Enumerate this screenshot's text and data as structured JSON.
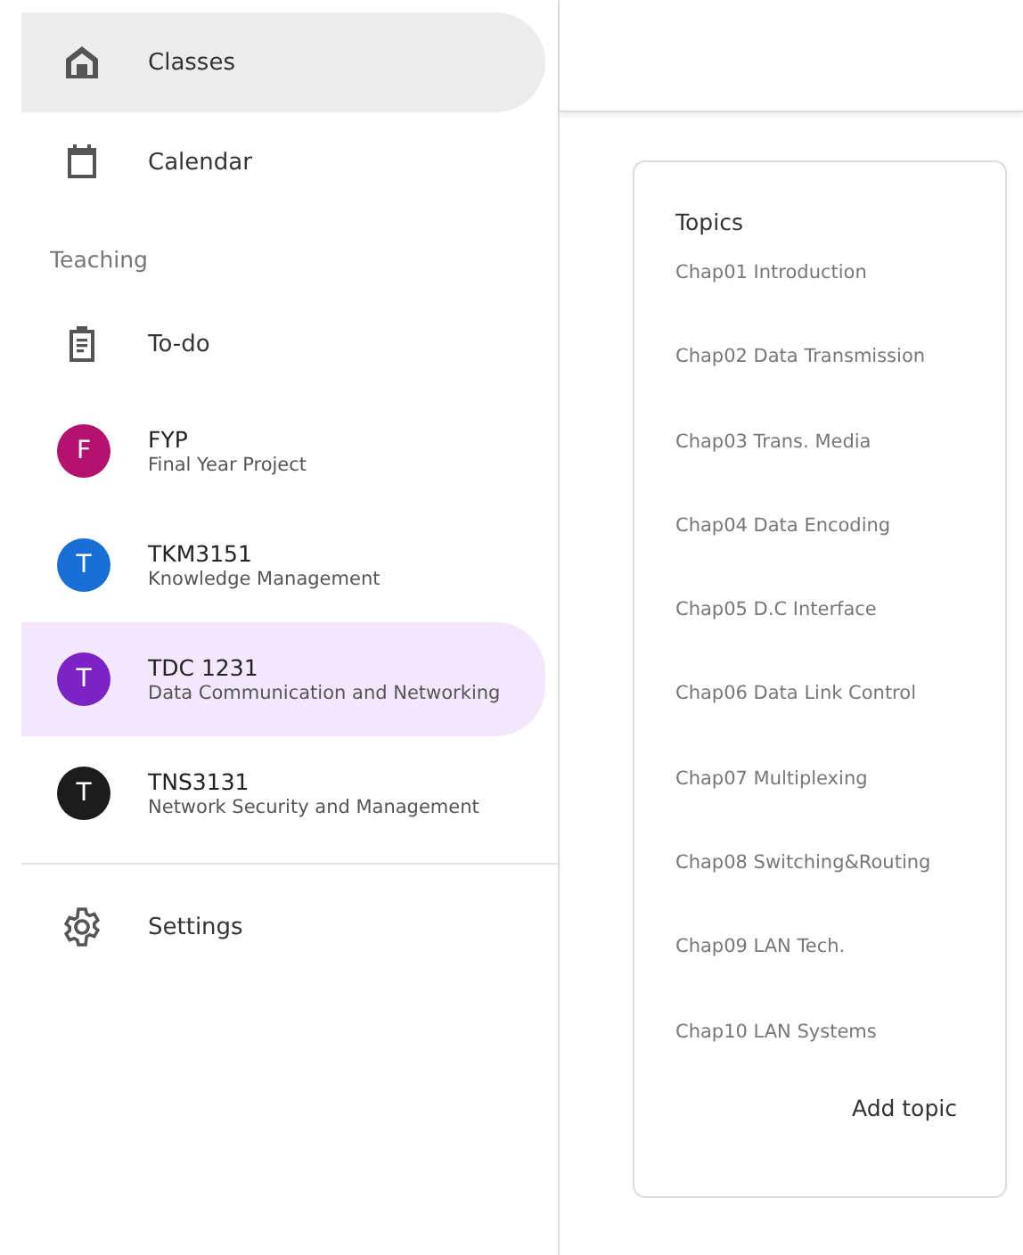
{
  "nav": [
    {
      "kind": "home",
      "label": "Classes",
      "selected": true
    },
    {
      "kind": "calendar",
      "label": "Calendar",
      "selected": false
    }
  ],
  "section_label": "Teaching",
  "todo": {
    "label": "To-do",
    "selected": false
  },
  "classes": [
    {
      "letter": "F",
      "color": "#b5126f",
      "title": "FYP",
      "subtitle": "Final Year Project",
      "selected": false
    },
    {
      "letter": "T",
      "color": "#1a6fd6",
      "title": "TKM3151",
      "subtitle": "Knowledge Management",
      "selected": false
    },
    {
      "letter": "T",
      "color": "#7b23c4",
      "title": "TDC 1231",
      "subtitle": "Data Communication and Networking",
      "selected": true
    },
    {
      "letter": "T",
      "color": "#1c1c1c",
      "title": "TNS3131",
      "subtitle": "Network Security and Management",
      "selected": false
    }
  ],
  "settings": {
    "label": "Settings",
    "selected": false
  },
  "topics": {
    "title": "Topics",
    "items": [
      "Chap01 Introduction",
      "Chap02 Data Transmission",
      "Chap03 Trans. Media",
      "Chap04 Data Encoding",
      "Chap05 D.C Interface",
      "Chap06 Data Link Control",
      "Chap07 Multiplexing",
      "Chap08 Switching&Routing",
      "Chap09 LAN Tech.",
      "Chap10 LAN Systems"
    ],
    "add_button": "Add topic"
  }
}
